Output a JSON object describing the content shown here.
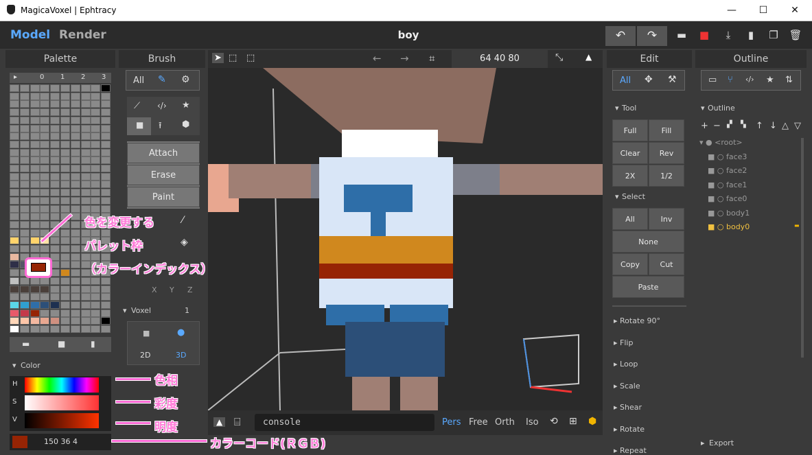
{
  "window": {
    "title": "MagicaVoxel | Ephtracy"
  },
  "modes": {
    "model": "Model",
    "render": "Render"
  },
  "doc_name": "boy",
  "palette": {
    "title": "Palette",
    "tabs": [
      "▸",
      "0",
      "1",
      "2",
      "3"
    ]
  },
  "brush": {
    "title": "Brush",
    "all": "All",
    "attach": "Attach",
    "erase": "Erase",
    "paint": "Paint",
    "mirror": [
      "X",
      "Y",
      "Z"
    ],
    "voxel_label": "Voxel",
    "voxel_value": "1",
    "dim_2d": "2D",
    "dim_3d": "3D"
  },
  "toolbar": {
    "dims": "64  40  80"
  },
  "color": {
    "title": "Color",
    "h": "H",
    "s": "S",
    "v": "V",
    "values": "150  36  4",
    "accent": "#962404"
  },
  "edit": {
    "title": "Edit",
    "all": "All",
    "tool_section": "Tool",
    "tool_buttons": [
      "Full",
      "Fill",
      "Clear",
      "Rev",
      "2X",
      "1/2"
    ],
    "select_section": "Select",
    "select_buttons": [
      "All",
      "Inv"
    ],
    "none": "None",
    "copy": "Copy",
    "cut": "Cut",
    "paste": "Paste",
    "collapsed": [
      "Rotate 90°",
      "Flip",
      "Loop",
      "Scale",
      "Shear",
      "Rotate",
      "Repeat"
    ]
  },
  "outline": {
    "title": "Outline",
    "section": "Outline",
    "items": [
      "<root>",
      "face3",
      "face2",
      "face1",
      "face0",
      "body1",
      "body0"
    ],
    "export": "Export"
  },
  "viewport": {
    "console": "console",
    "views": [
      "Pers",
      "Free",
      "Orth",
      "Iso"
    ]
  },
  "annotations": {
    "palette_frame_1": "色を変更する",
    "palette_frame_2": "パレット枠",
    "palette_frame_3": "（カラーインデックス）",
    "hue": "色相",
    "saturation": "彩度",
    "brightness": "明度",
    "color_code": "カラーコード(ＲＧＢ)"
  }
}
